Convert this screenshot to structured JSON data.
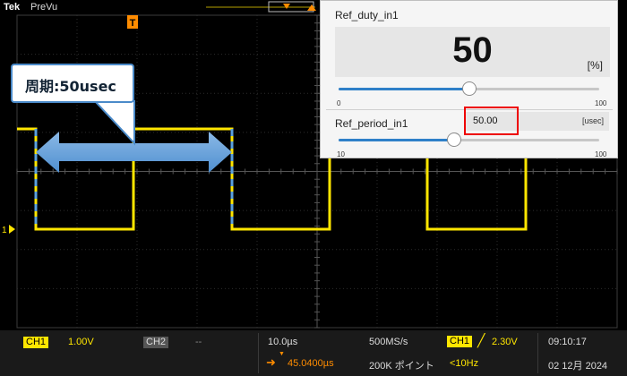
{
  "app": {
    "brand": "Tek",
    "mode": "PreVu"
  },
  "callout": {
    "text": "周期:50usec"
  },
  "panel": {
    "duty_title": "Ref_duty_in1",
    "duty_value": "50",
    "duty_unit": "[%]",
    "duty_min": "0",
    "duty_max": "100",
    "duty_level_percent": 50,
    "period_title": "Ref_period_in1",
    "period_value": "50.00",
    "period_unit": "[usec]",
    "period_min": "10",
    "period_max": "100",
    "period_level_value": 50
  },
  "markers": {
    "trigger": "T",
    "channel1": "1"
  },
  "status": {
    "ch1_label": "CH1",
    "ch1_scale": "1.00V",
    "ch2_label": "CH2",
    "ch2_scale": "--",
    "timebase": "10.0µs",
    "delay": "45.0400µs",
    "sample_rate": "500MS/s",
    "record_length": "200K ポイント",
    "trig_source": "CH1",
    "trig_level": "2.30V",
    "trig_freq": "<10Hz",
    "time": "09:10:17",
    "date": "02 12月 2024"
  },
  "colors": {
    "ch1": "#ffe600",
    "accent": "#ff8c00",
    "callout_border": "#4a8ac9",
    "highlight": "#ff0000"
  }
}
